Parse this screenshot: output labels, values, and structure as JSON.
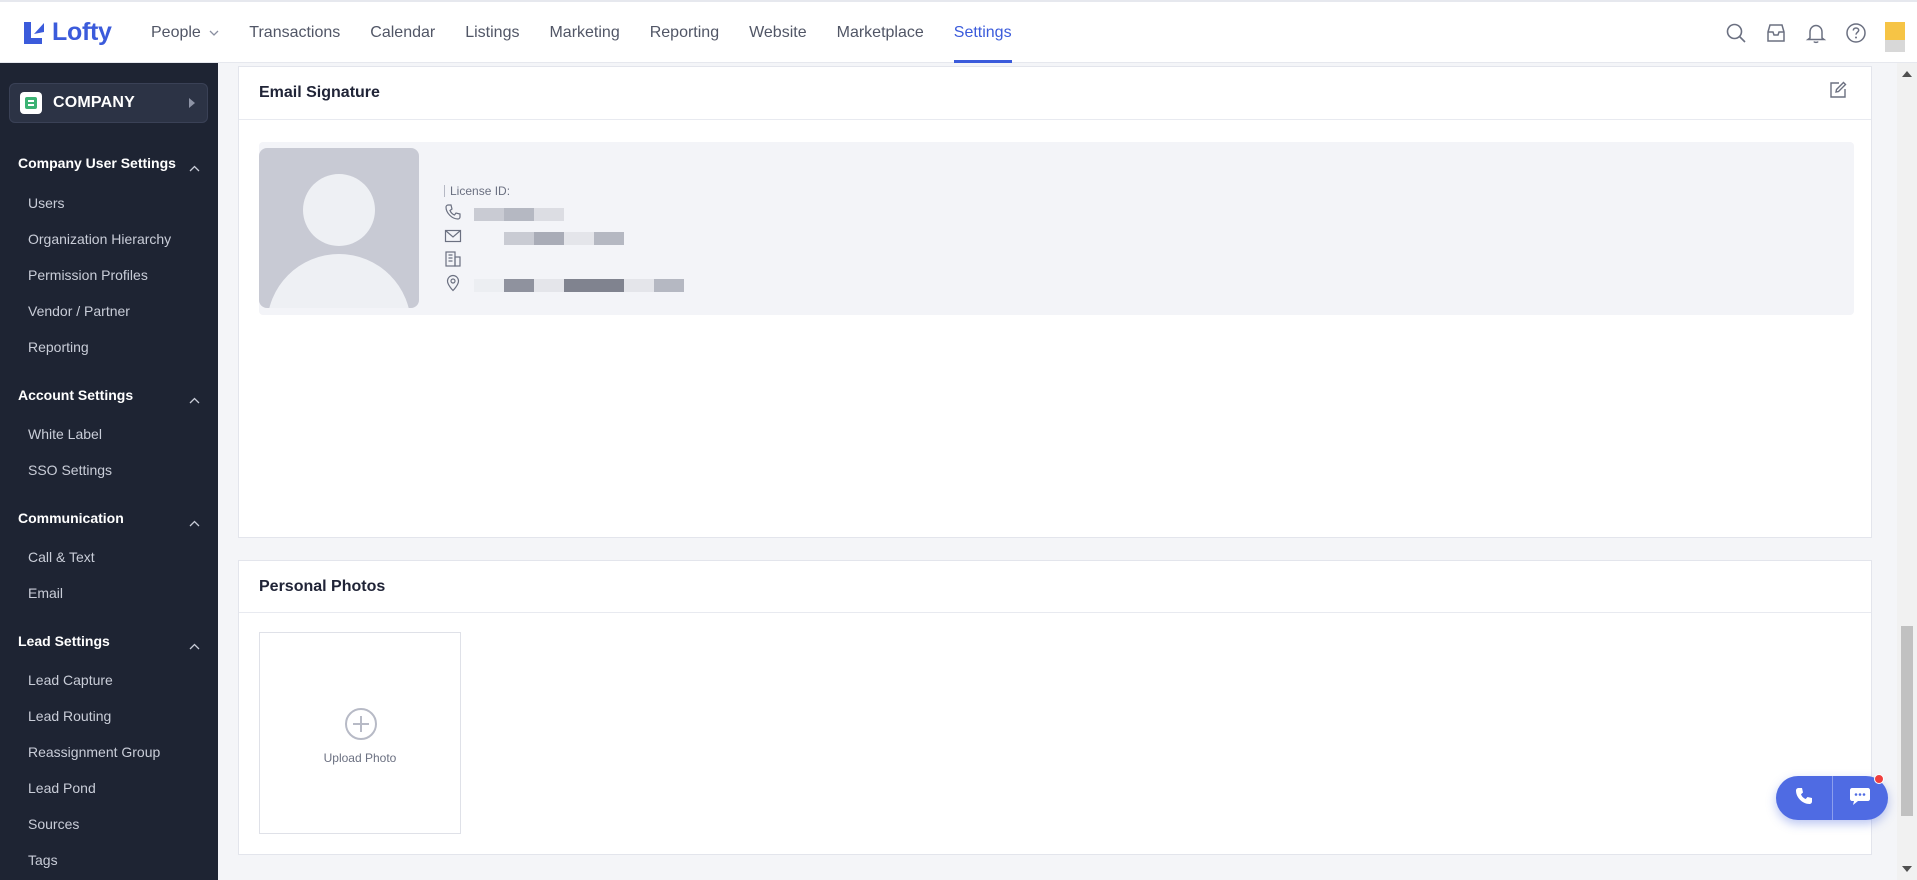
{
  "app": {
    "logo_text": "Lofty"
  },
  "nav": {
    "items": [
      {
        "label": "People",
        "has_dropdown": true
      },
      {
        "label": "Transactions"
      },
      {
        "label": "Calendar"
      },
      {
        "label": "Listings"
      },
      {
        "label": "Marketing"
      },
      {
        "label": "Reporting"
      },
      {
        "label": "Website"
      },
      {
        "label": "Marketplace"
      },
      {
        "label": "Settings",
        "active": true
      }
    ],
    "icons": [
      "search-icon",
      "inbox-icon",
      "bell-icon",
      "help-icon"
    ]
  },
  "sidebar": {
    "company": {
      "label": "COMPANY"
    },
    "sections": [
      {
        "title": "Company User Settings",
        "items": [
          "Users",
          "Organization Hierarchy",
          "Permission Profiles",
          "Vendor / Partner",
          "Reporting"
        ]
      },
      {
        "title": "Account Settings",
        "items": [
          "White Label",
          "SSO Settings"
        ]
      },
      {
        "title": "Communication",
        "items": [
          "Call & Text",
          "Email"
        ]
      },
      {
        "title": "Lead Settings",
        "items": [
          "Lead Capture",
          "Lead Routing",
          "Reassignment Group",
          "Lead Pond",
          "Sources",
          "Tags"
        ]
      }
    ]
  },
  "email_signature": {
    "title": "Email Signature",
    "license_label": "License ID:"
  },
  "personal_photos": {
    "title": "Personal Photos",
    "upload_label": "Upload Photo"
  },
  "colors": {
    "accent": "#3b5bdb",
    "sidebar_bg": "#1e2433",
    "page_bg": "#f4f5f8"
  }
}
